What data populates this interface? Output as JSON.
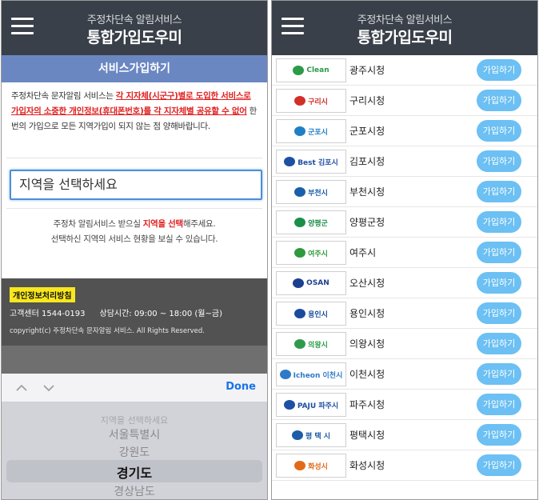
{
  "header": {
    "subtitle": "주정차단속 알림서비스",
    "title": "통합가입도우미"
  },
  "signup": {
    "section_title": "서비스가입하기",
    "notice_prefix": "주정차단속 문자알림 서비스는 ",
    "notice_highlight": "각 지자체(시군구)별로 도입한 서비스로 가입자의 소중한 개인정보(휴대폰번호)를 각 지자체별 공유할 수 없어",
    "notice_suffix": " 한번의 가입으로 모든 지역가입이 되지 않는 점 양해바랍니다.",
    "region_select": "지역을 선택하세요",
    "help_line1_pre": "주정차 알림서비스 받으실 ",
    "help_line1_hl": "지역을 선택",
    "help_line1_post": "해주세요.",
    "help_line2": "선택하신 지역의 서비스 현황을 보실 수 있습니다."
  },
  "footer": {
    "privacy_link": "개인정보처리방침",
    "customer_center": "고객센터 1544-0193",
    "hours": "상담시간: 09:00 ~ 18:00 (월~금)",
    "copyright": "copyright(c) 주정차단속 문자알림 서비스. All Rights Reserved."
  },
  "picker": {
    "done_label": "Done",
    "options": [
      "지역을 선택하세요",
      "서울특별시",
      "강원도",
      "경기도",
      "경상남도"
    ],
    "selected": "경기도"
  },
  "cities": [
    {
      "name": "광주시청",
      "logo_text": "Clean",
      "color": "#2c9a48"
    },
    {
      "name": "구리시청",
      "logo_text": "구리시",
      "color": "#d22f27"
    },
    {
      "name": "군포시청",
      "logo_text": "군포시",
      "color": "#1f7fc4"
    },
    {
      "name": "김포시청",
      "logo_text": "Best 김포시",
      "color": "#1d4fa3"
    },
    {
      "name": "부천시청",
      "logo_text": "부천시",
      "color": "#1b5faa"
    },
    {
      "name": "양평군청",
      "logo_text": "양평군",
      "color": "#1a8f4a"
    },
    {
      "name": "여주시",
      "logo_text": "여주시",
      "color": "#2e9a3c"
    },
    {
      "name": "오산시청",
      "logo_text": "OSAN",
      "color": "#1d3f8f"
    },
    {
      "name": "용인시청",
      "logo_text": "용인시",
      "color": "#1a4b9c"
    },
    {
      "name": "의왕시청",
      "logo_text": "의왕시",
      "color": "#2f9a4a"
    },
    {
      "name": "이천시청",
      "logo_text": "Icheon 이천시",
      "color": "#2f7ac8"
    },
    {
      "name": "파주시청",
      "logo_text": "PAJU 파주시",
      "color": "#1d4fa3"
    },
    {
      "name": "평택시청",
      "logo_text": "평 택 시",
      "color": "#1d5ca8"
    },
    {
      "name": "화성시청",
      "logo_text": "화성시",
      "color": "#e06a1a"
    }
  ],
  "join_label": "가입하기",
  "colors": {
    "header_bg": "#3a4049",
    "section_bar": "#6b87c2",
    "join_button": "#6cc0f3",
    "highlight_red": "#e02020",
    "privacy_yellow": "#f8e71c"
  }
}
